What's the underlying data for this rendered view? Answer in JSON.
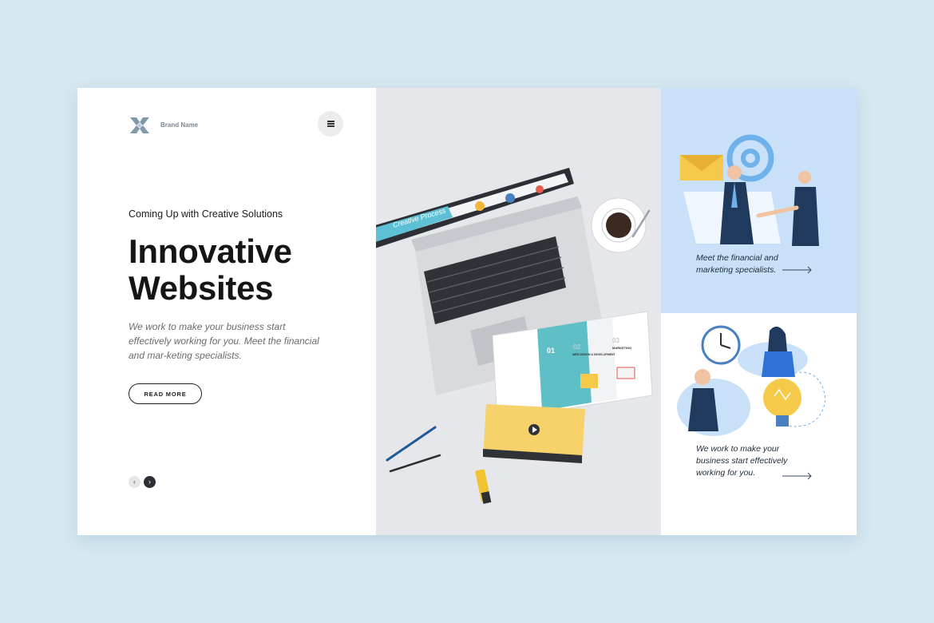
{
  "brand": {
    "name": "Brand Name"
  },
  "hero": {
    "kicker": "Coming Up with Creative Solutions",
    "headline_line1": "Innovative",
    "headline_line2": "Websites",
    "body": "We work to make your business start effectively working for you. Meet the financial and mar-keting specialists.",
    "cta_label": "READ MORE"
  },
  "carousel": {
    "prev_icon": "‹",
    "next_icon": "›"
  },
  "laptop_screen": {
    "title": "Creative Process"
  },
  "brochure": {
    "section1_num": "01",
    "section2_num": "02",
    "section3_num": "03",
    "section2_title": "WEB DESIGN & DEVELOPMENT",
    "section3_title": "MARKETING"
  },
  "cards": [
    {
      "text": "Meet the financial and marketing specialists."
    },
    {
      "text": "We work to make your business start effectively working for you."
    }
  ],
  "colors": {
    "accent_teal": "#5fbfc6",
    "accent_yellow": "#f5c94a",
    "navy": "#1f3a5c",
    "light_blue_panel": "#c8e1f8",
    "middle_panel": "#e6e7eb"
  },
  "icons": [
    "brand-logo-icon",
    "menu-icon",
    "chevron-left-icon",
    "chevron-right-icon",
    "arrow-right-icon",
    "at-sign-icon",
    "envelope-icon",
    "clock-icon",
    "lightbulb-icon",
    "play-icon"
  ]
}
